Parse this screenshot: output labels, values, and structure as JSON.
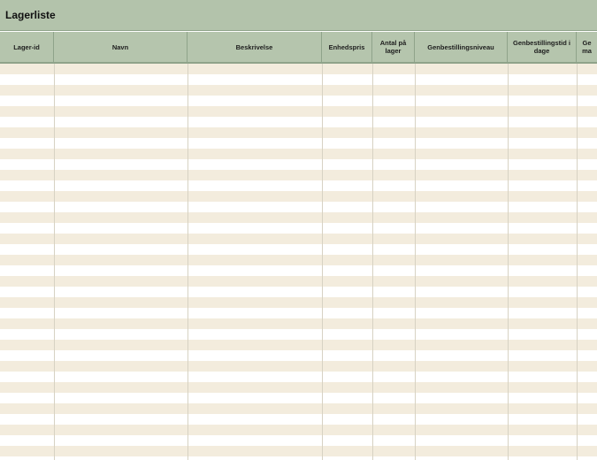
{
  "sheet": {
    "title": "Lagerliste"
  },
  "columns": [
    {
      "label": "Lager-id"
    },
    {
      "label": "Navn"
    },
    {
      "label": "Beskrivelse"
    },
    {
      "label": "Enhedspris"
    },
    {
      "label": "Antal på lager"
    },
    {
      "label": "Genbestillingsniveau"
    },
    {
      "label": "Genbestillingstid i dage"
    },
    {
      "label": "Ge ma"
    }
  ],
  "colors": {
    "title_bar": "#b3c3ab",
    "header": "#b5c5ad",
    "band": "#f3ecdd",
    "grid": "#d7d2c3"
  }
}
